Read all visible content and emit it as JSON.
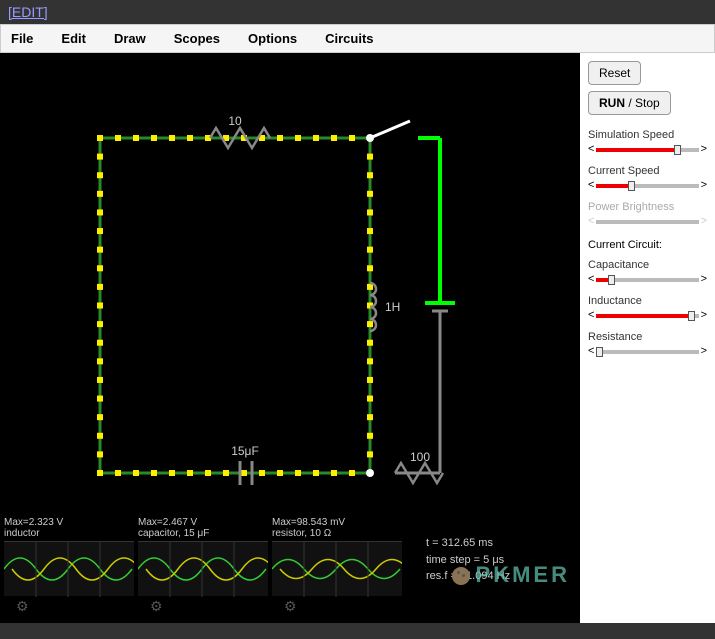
{
  "edit_link": "[EDIT]",
  "menu": {
    "file": "File",
    "edit": "Edit",
    "draw": "Draw",
    "scopes": "Scopes",
    "options": "Options",
    "circuits": "Circuits"
  },
  "sidebar": {
    "reset": "Reset",
    "run": "RUN",
    "stop": " / Stop",
    "sim_speed": "Simulation Speed",
    "cur_speed": "Current Speed",
    "power_bright": "Power Brightness",
    "current_circuit": "Current Circuit:",
    "capacitance": "Capacitance",
    "inductance": "Inductance",
    "resistance": "Resistance"
  },
  "components": {
    "r1": "10",
    "l1": "1H",
    "c1": "15μF",
    "r2": "100"
  },
  "scopes": [
    {
      "line1": "Max=2.323 V",
      "line2": "inductor"
    },
    {
      "line1": "Max=2.467 V",
      "line2": "capacitor, 15 μF"
    },
    {
      "line1": "Max=98.543 mV",
      "line2": "resistor, 10 Ω"
    }
  ],
  "info": {
    "t": "t = 312.65 ms",
    "step": "time step = 5 μs",
    "resf": "res.f = 41.094 Hz"
  },
  "watermark": "PKMER"
}
